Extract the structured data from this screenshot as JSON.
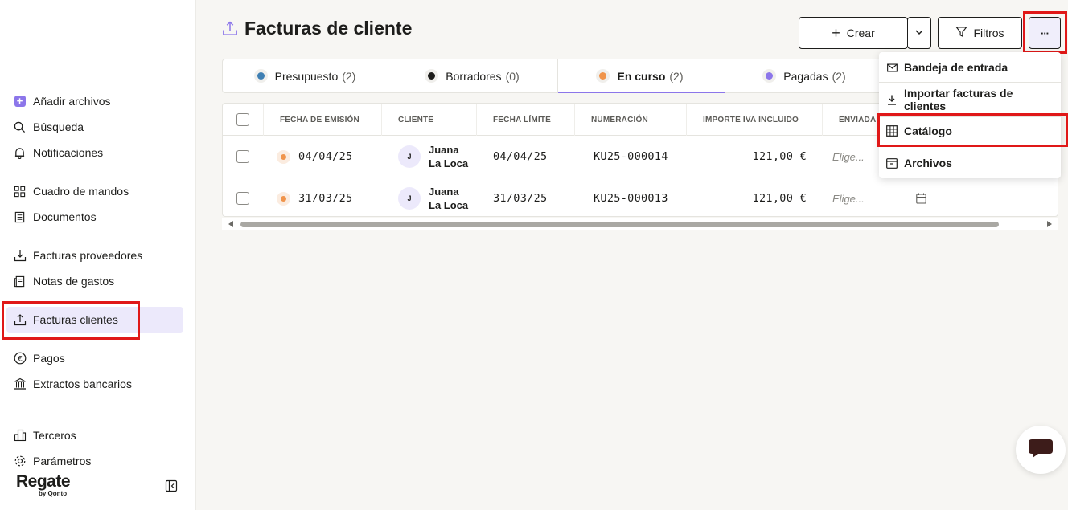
{
  "sidebar": {
    "items": [
      {
        "label": "Añadir archivos",
        "icon": "plus-square-icon"
      },
      {
        "label": "Búsqueda",
        "icon": "search-icon"
      },
      {
        "label": "Notificaciones",
        "icon": "bell-icon"
      },
      {
        "label": "Cuadro de mandos",
        "icon": "dashboard-icon"
      },
      {
        "label": "Documentos",
        "icon": "document-icon"
      },
      {
        "label": "Facturas proveedores",
        "icon": "download-tray-icon"
      },
      {
        "label": "Notas de gastos",
        "icon": "receipt-icon"
      },
      {
        "label": "Facturas clientes",
        "icon": "upload-tray-icon"
      },
      {
        "label": "Pagos",
        "icon": "euro-circle-icon"
      },
      {
        "label": "Extractos bancarios",
        "icon": "bank-icon"
      },
      {
        "label": "Terceros",
        "icon": "buildings-icon"
      },
      {
        "label": "Parámetros",
        "icon": "gear-icon"
      }
    ],
    "active": "Facturas clientes",
    "logo": "Regate",
    "logo_sub": "by Qonto"
  },
  "header": {
    "title": "Facturas de cliente",
    "create_label": "Crear",
    "filters_label": "Filtros",
    "more_label": "···"
  },
  "tabs": [
    {
      "label": "Presupuesto",
      "count": "(2)",
      "dot_color": "#3f7fb3"
    },
    {
      "label": "Borradores",
      "count": "(0)",
      "dot_color": "#1d1d1b"
    },
    {
      "label": "En curso",
      "count": "(2)",
      "dot_color": "#f0944b"
    },
    {
      "label": "Pagadas",
      "count": "(2)",
      "dot_color": "#8c76ea"
    }
  ],
  "table": {
    "columns": [
      "FECHA DE EMISIÓN",
      "CLIENTE",
      "FECHA LÍMITE",
      "NUMERACIÓN",
      "IMPORTE IVA INCLUIDO",
      "ENVIADA"
    ],
    "rows": [
      {
        "issue_date": "04/04/25",
        "client_initial": "J",
        "client": "Juana La Loca",
        "due_date": "04/04/25",
        "number": "KU25-000014",
        "amount": "121,00 €",
        "sent": "Elige..."
      },
      {
        "issue_date": "31/03/25",
        "client_initial": "J",
        "client": "Juana La Loca",
        "due_date": "31/03/25",
        "number": "KU25-000013",
        "amount": "121,00 €",
        "sent": "Elige..."
      }
    ]
  },
  "menu": {
    "items": [
      {
        "label": "Bandeja de entrada",
        "icon": "mail-icon"
      },
      {
        "label": "Importar facturas de clientes",
        "icon": "download-icon"
      },
      {
        "label": "Catálogo",
        "icon": "grid-table-icon"
      },
      {
        "label": "Archivos",
        "icon": "archive-box-icon"
      }
    ]
  },
  "colors": {
    "accent": "#8c76ea",
    "highlight": "#e01818",
    "in_progress": "#f0944b"
  }
}
